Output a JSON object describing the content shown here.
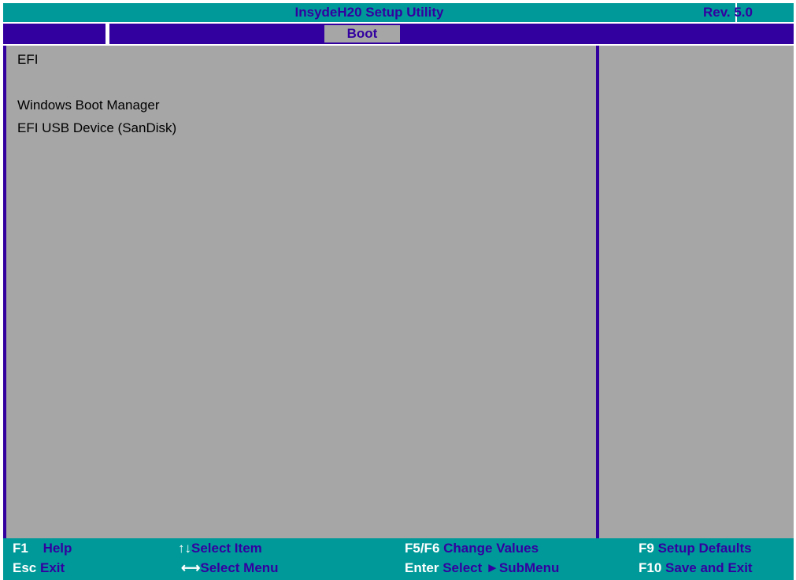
{
  "header": {
    "title": "InsydeH20 Setup Utility",
    "revision": "Rev. 5.0"
  },
  "menu": {
    "tabs": [
      {
        "label": "Boot",
        "active": true
      }
    ]
  },
  "boot_list": {
    "section": "EFI",
    "items": [
      "Windows Boot Manager",
      "EFI USB Device (SanDisk)"
    ]
  },
  "footer": {
    "f1_key": "F1",
    "f1_desc": "Help",
    "esc_key": "Esc",
    "esc_desc": "Exit",
    "updown_desc": "Select Item",
    "leftright_desc": "Select Menu",
    "f5f6_key": "F5/F6",
    "f5f6_desc": "Change Values",
    "enter_key": "Enter",
    "enter_desc": "Select",
    "submenu_desc": "SubMenu",
    "f9_key": "F9",
    "f9_desc": "Setup Defaults",
    "f10_key": "F10",
    "f10_desc": "Save and Exit"
  },
  "colors": {
    "teal": "#009999",
    "navy": "#3300a0",
    "panel_gray": "#a6a6a6",
    "white": "#ffffff"
  },
  "icons": {
    "updown": "up-down-arrows-icon",
    "leftright": "left-right-arrow-icon",
    "submenu": "right-triangle-icon"
  }
}
